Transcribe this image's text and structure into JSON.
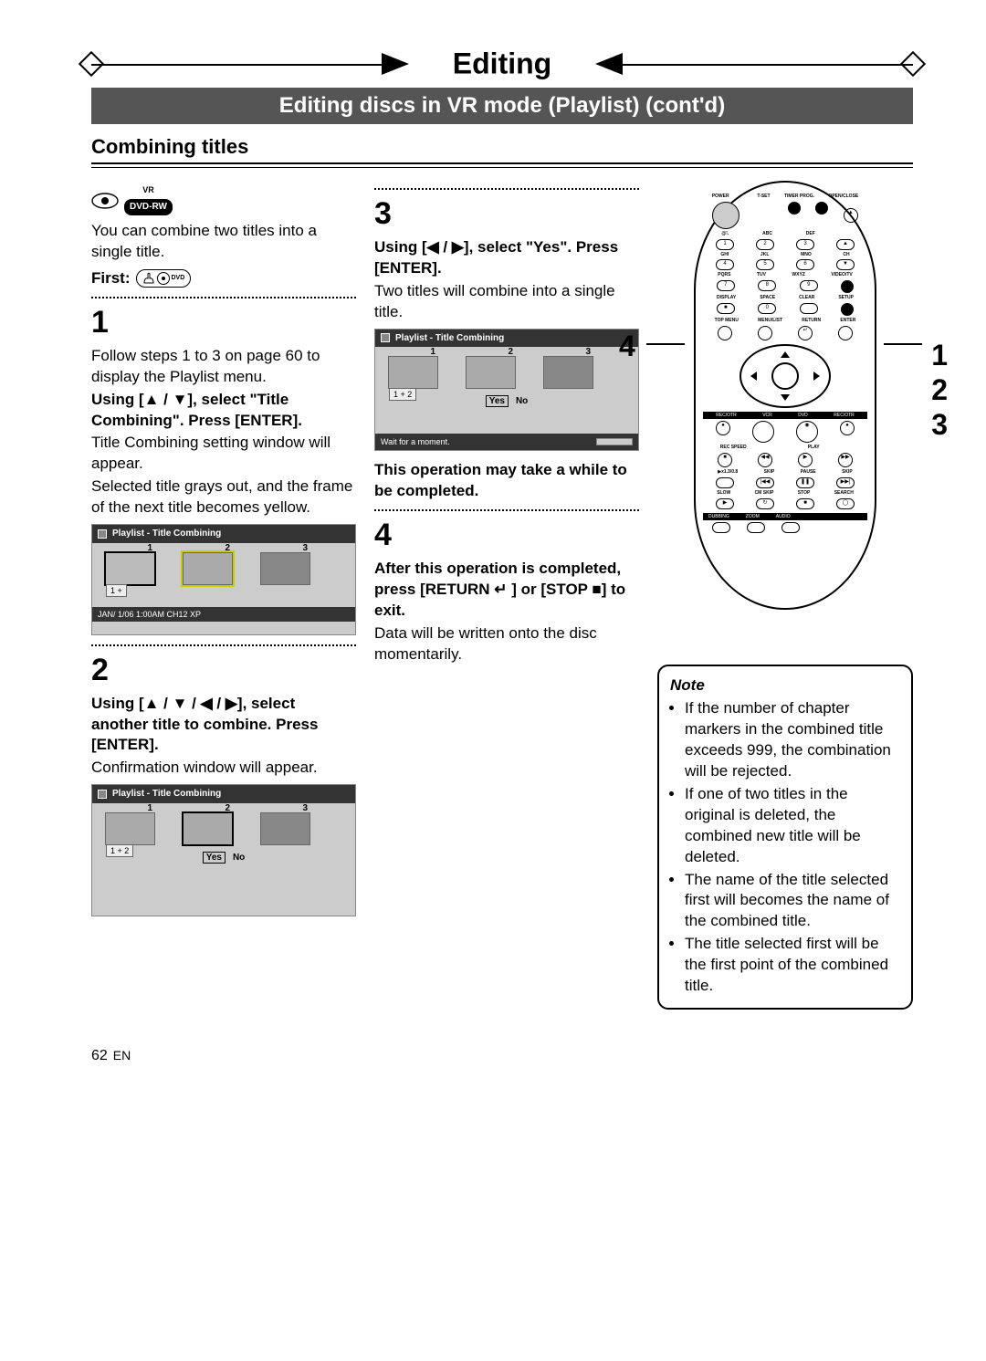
{
  "header": {
    "main": "Editing",
    "sub": "Editing discs in VR mode (Playlist) (cont'd)"
  },
  "section_title": "Combining titles",
  "disc_badge_top": "VR",
  "disc_badge": "DVD-RW",
  "intro": "You can combine two titles into a single title.",
  "first_label": "First:",
  "first_icon_text": "DVD",
  "step1": {
    "num": "1",
    "p1": "Follow steps 1 to 3 on page 60 to display the Playlist menu.",
    "p2": "Using [▲ / ▼], select \"Title Combining\". Press [ENTER].",
    "p3": "Title Combining setting window will appear.",
    "p4": "Selected title grays out, and the frame of the next title becomes yellow.",
    "screen_title": "Playlist - Title Combining",
    "t1": "1",
    "t2": "2",
    "t3": "3",
    "combo": "1  +",
    "status": "JAN/ 1/06 1:00AM CH12 XP"
  },
  "step2": {
    "num": "2",
    "p1": "Using [▲ / ▼ / ◀ / ▶], select another title to combine. Press [ENTER].",
    "p2": "Confirmation window will appear.",
    "screen_title": "Playlist - Title Combining",
    "t1": "1",
    "t2": "2",
    "t3": "3",
    "combo": "1   +   2",
    "yes": "Yes",
    "no": "No"
  },
  "step3": {
    "num": "3",
    "p1": "Using [◀ / ▶], select \"Yes\". Press [ENTER].",
    "p2": "Two titles will combine into a single title.",
    "screen_title": "Playlist - Title Combining",
    "t1": "1",
    "t2": "2",
    "t3": "3",
    "combo": "1   +   2",
    "yes": "Yes",
    "no": "No",
    "wait": "Wait for a moment.",
    "p3": "This operation may take a while to be completed."
  },
  "step4": {
    "num": "4",
    "p1": "After this operation is completed, press [RETURN ↵ ] or [STOP ■] to exit.",
    "p2": "Data will be written onto the disc momentarily."
  },
  "note": {
    "title": "Note",
    "items": [
      "If the number of chapter markers in the combined title exceeds 999, the combination will be rejected.",
      "If one of two titles in the original is deleted, the combined new title will be deleted.",
      "The name of the title selected first will becomes the name of the combined title.",
      "The title selected first will be the first point of the combined title."
    ]
  },
  "remote": {
    "row1": [
      "POWER",
      "",
      "T-SET",
      "TIMER PROG.",
      "OPEN/CLOSE"
    ],
    "row_sym": [
      "@!.",
      "ABC",
      "DEF",
      ""
    ],
    "row_num1": [
      "1",
      "2",
      "3",
      "▲"
    ],
    "row_alpha2": [
      "GHI",
      "JKL",
      "MNO",
      "CH"
    ],
    "row_num2": [
      "4",
      "5",
      "6",
      "▼"
    ],
    "row_alpha3": [
      "PQRS",
      "TUV",
      "WXYZ",
      "VIDEO/TV"
    ],
    "row_num3": [
      "7",
      "8",
      "9",
      ""
    ],
    "row_alpha4": [
      "DISPLAY",
      "SPACE",
      "CLEAR",
      "SETUP"
    ],
    "row_num4": [
      "",
      "0",
      "",
      ""
    ],
    "row_menu": [
      "TOP MENU",
      "MENU/LIST",
      "RETURN",
      "ENTER"
    ],
    "strip1": [
      "REC/OTR",
      "VCR",
      "DVD",
      "REC/OTR"
    ],
    "row_p1": [
      "REC SPEED",
      "",
      "PLAY",
      ""
    ],
    "row_p2": [
      "▶x1.3/0.8",
      "SKIP",
      "PAUSE",
      "SKIP"
    ],
    "row_p3": [
      "SLOW",
      "CM SKIP",
      "STOP",
      "SEARCH"
    ],
    "strip2": [
      "DUBBING",
      "ZOOM",
      "AUDIO"
    ]
  },
  "callouts": {
    "c1": "1",
    "c2": "2",
    "c3": "3",
    "c4": "4"
  },
  "footer": {
    "page": "62",
    "lang": "EN"
  }
}
